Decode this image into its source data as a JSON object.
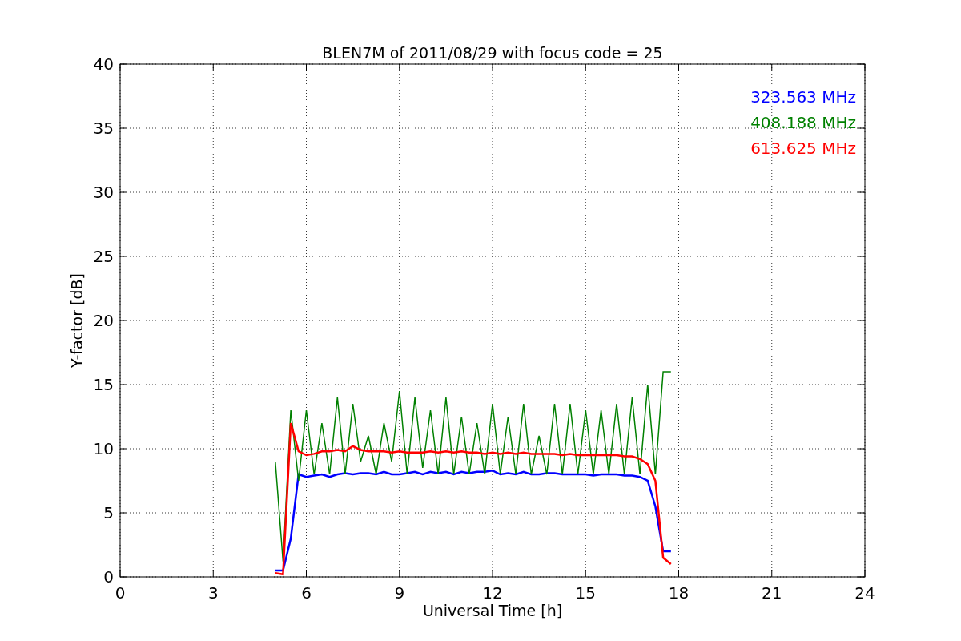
{
  "chart_data": {
    "type": "line",
    "title": "BLEN7M of 2011/08/29 with focus code = 25",
    "xlabel": "Universal Time [h]",
    "ylabel": "Y-factor [dB]",
    "x": [
      5,
      5.25,
      5.5,
      5.75,
      6,
      6.25,
      6.5,
      6.75,
      7,
      7.25,
      7.5,
      7.75,
      8,
      8.25,
      8.5,
      8.75,
      9,
      9.25,
      9.5,
      9.75,
      10,
      10.25,
      10.5,
      10.75,
      11,
      11.25,
      11.5,
      11.75,
      12,
      12.25,
      12.5,
      12.75,
      13,
      13.25,
      13.5,
      13.75,
      14,
      14.25,
      14.5,
      14.75,
      15,
      15.25,
      15.5,
      15.75,
      16,
      16.25,
      16.5,
      16.75,
      17,
      17.25,
      17.5,
      17.75
    ],
    "series": [
      {
        "name": "323.563 MHz",
        "color": "#0000ff",
        "values": [
          0.5,
          0.5,
          3,
          8,
          7.8,
          7.9,
          8,
          7.8,
          8,
          8.1,
          8,
          8.1,
          8.1,
          8,
          8.2,
          8,
          8,
          8.1,
          8.2,
          8,
          8.2,
          8.1,
          8.2,
          8,
          8.2,
          8.1,
          8.2,
          8.2,
          8.3,
          8,
          8.1,
          8,
          8.2,
          8,
          8,
          8.1,
          8.1,
          8,
          8,
          8,
          8,
          7.9,
          8,
          8,
          8,
          7.9,
          7.9,
          7.8,
          7.5,
          5.5,
          2,
          2
        ]
      },
      {
        "name": "408.188 MHz",
        "color": "#008000",
        "values": [
          9,
          1.2,
          13,
          7.5,
          13,
          8,
          12,
          8,
          14,
          8,
          13.5,
          9,
          11,
          8,
          12,
          9,
          14.5,
          8,
          14,
          8.5,
          13,
          8,
          14,
          8,
          12.5,
          8,
          12,
          8,
          13.5,
          8,
          12.5,
          8,
          13.5,
          8,
          11,
          8,
          13.5,
          8,
          13.5,
          8,
          13,
          8,
          13,
          8,
          13.5,
          8,
          14,
          8,
          15,
          8,
          16,
          16
        ]
      },
      {
        "name": "613.625 MHz",
        "color": "#ff0000",
        "values": [
          0.3,
          0.2,
          12,
          9.8,
          9.5,
          9.6,
          9.8,
          9.8,
          9.9,
          9.8,
          10.2,
          9.9,
          9.8,
          9.8,
          9.8,
          9.7,
          9.8,
          9.7,
          9.7,
          9.7,
          9.8,
          9.7,
          9.8,
          9.7,
          9.8,
          9.7,
          9.7,
          9.6,
          9.7,
          9.6,
          9.7,
          9.6,
          9.7,
          9.6,
          9.6,
          9.6,
          9.6,
          9.5,
          9.6,
          9.5,
          9.5,
          9.5,
          9.5,
          9.5,
          9.5,
          9.4,
          9.4,
          9.2,
          8.8,
          7.5,
          1.5,
          1
        ]
      }
    ],
    "xlim": [
      0,
      24
    ],
    "ylim": [
      0,
      40
    ],
    "xticks": [
      0,
      3,
      6,
      9,
      12,
      15,
      18,
      21,
      24
    ],
    "yticks": [
      0,
      5,
      10,
      15,
      20,
      25,
      30,
      35,
      40
    ],
    "grid": true
  }
}
